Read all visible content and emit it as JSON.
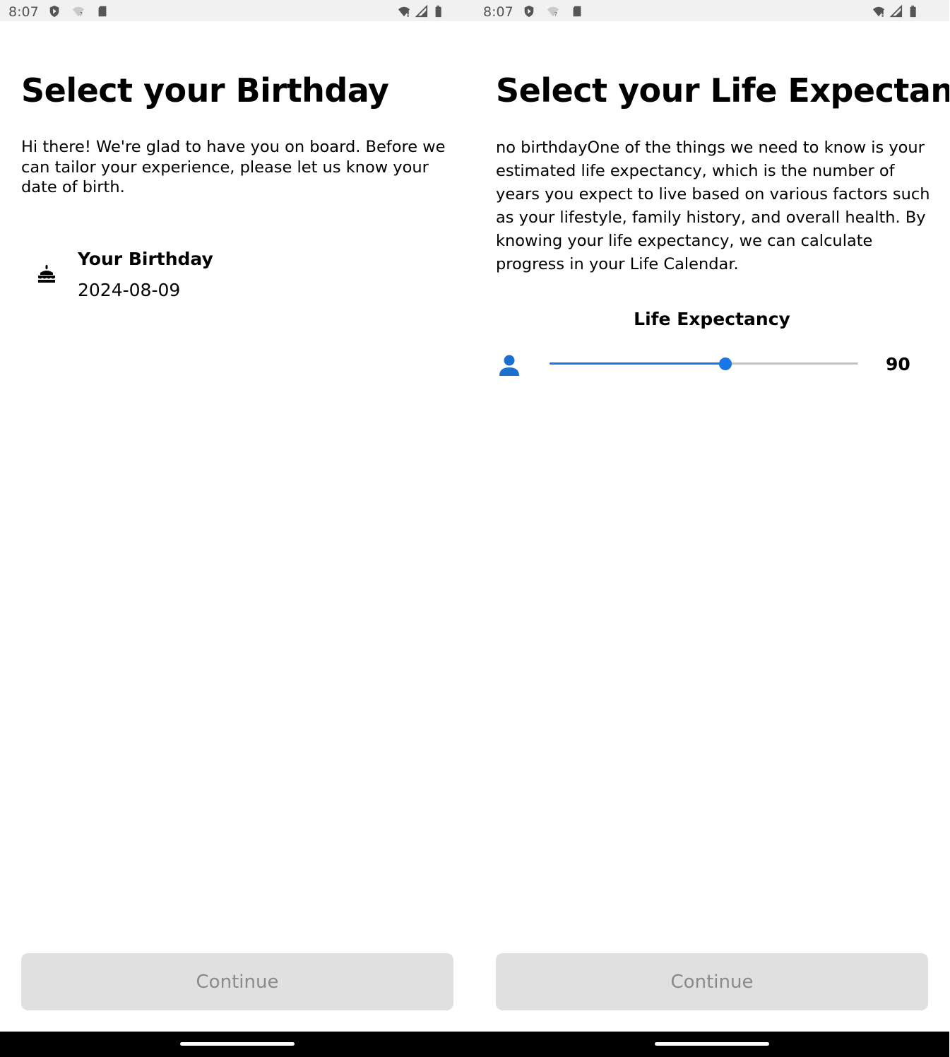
{
  "screens": [
    {
      "status": {
        "time": "8:07"
      },
      "title": "Select your Birthday",
      "intro": "Hi there! We're glad to have you on board. Before we can tailor your experience, please let us know your date of birth.",
      "birthday": {
        "icon": "cake-icon",
        "label": "Your Birthday",
        "value": "2024-08-09"
      },
      "continue_label": "Continue"
    },
    {
      "status": {
        "time": "8:07"
      },
      "title": "Select your Life Expectancy",
      "intro": "no birthdayOne of the things we need to know is your estimated life expectancy, which is the number of years you expect to live based on various factors such as your lifestyle, family history, and overall health. By knowing your life expectancy, we can calculate progress in your Life Calendar.",
      "life_expectancy": {
        "icon": "person-icon",
        "label": "Life Expectancy",
        "value": "90",
        "slider_fraction": 0.57
      },
      "continue_label": "Continue"
    }
  ],
  "colors": {
    "accent": "#1976e6",
    "button_disabled_bg": "#e0e0e0",
    "button_disabled_text": "#8a8a8a",
    "statusbar_bg": "#f1f1f1"
  }
}
